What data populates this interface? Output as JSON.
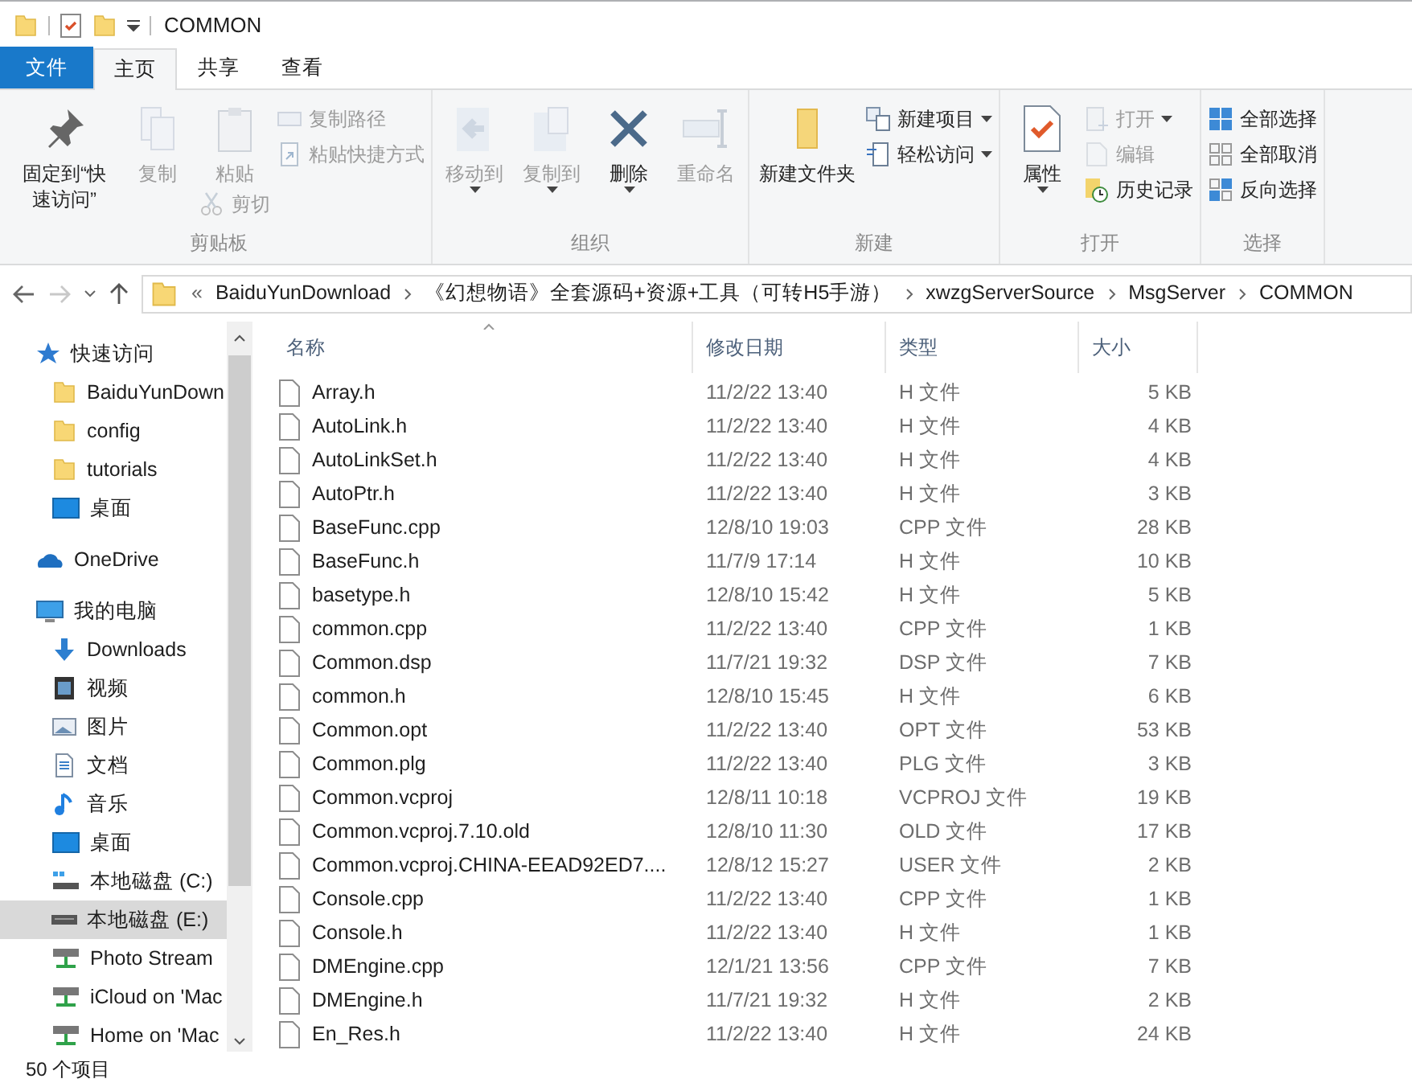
{
  "window": {
    "title": "COMMON"
  },
  "tabs": [
    {
      "label": "文件",
      "kind": "file",
      "selected": false
    },
    {
      "label": "主页",
      "kind": "tab",
      "selected": true
    },
    {
      "label": "共享",
      "kind": "tab",
      "selected": false
    },
    {
      "label": "查看",
      "kind": "tab",
      "selected": false
    }
  ],
  "ribbon": {
    "groups": [
      {
        "label": "剪贴板",
        "items": [
          {
            "kind": "large",
            "label": "固定到“快速访问”",
            "disabled": false,
            "dropdown": false
          },
          {
            "kind": "large",
            "label": "复制",
            "disabled": true,
            "dropdown": false
          },
          {
            "kind": "large",
            "label": "粘贴",
            "disabled": true,
            "dropdown": false,
            "below": {
              "label": "剪切",
              "disabled": true
            }
          },
          {
            "kind": "stack",
            "items": [
              {
                "label": "复制路径",
                "disabled": true,
                "dropdown": false
              },
              {
                "label": "粘贴快捷方式",
                "disabled": true,
                "dropdown": false
              }
            ]
          }
        ]
      },
      {
        "label": "组织",
        "items": [
          {
            "kind": "large",
            "label": "移动到",
            "disabled": true,
            "dropdown": true
          },
          {
            "kind": "large",
            "label": "复制到",
            "disabled": true,
            "dropdown": true
          },
          {
            "kind": "large",
            "label": "删除",
            "disabled": false,
            "dropdown": true
          },
          {
            "kind": "large",
            "label": "重命名",
            "disabled": true,
            "dropdown": false
          }
        ]
      },
      {
        "label": "新建",
        "items": [
          {
            "kind": "large",
            "label": "新建文件夹",
            "disabled": false,
            "dropdown": false
          },
          {
            "kind": "stack",
            "items": [
              {
                "label": "新建项目",
                "disabled": false,
                "dropdown": true
              },
              {
                "label": "轻松访问",
                "disabled": false,
                "dropdown": true
              }
            ]
          }
        ]
      },
      {
        "label": "打开",
        "items": [
          {
            "kind": "large",
            "label": "属性",
            "disabled": false,
            "dropdown": true
          },
          {
            "kind": "stack",
            "items": [
              {
                "label": "打开",
                "disabled": true,
                "dropdown": true
              },
              {
                "label": "编辑",
                "disabled": true,
                "dropdown": false
              },
              {
                "label": "历史记录",
                "disabled": false,
                "dropdown": false
              }
            ]
          }
        ]
      },
      {
        "label": "选择",
        "items": [
          {
            "kind": "stack",
            "items": [
              {
                "label": "全部选择",
                "disabled": false,
                "dropdown": false
              },
              {
                "label": "全部取消",
                "disabled": false,
                "dropdown": false
              },
              {
                "label": "反向选择",
                "disabled": false,
                "dropdown": false
              }
            ]
          }
        ]
      }
    ]
  },
  "address_bar": {
    "back_disabled": false,
    "forward_disabled": true,
    "overflow": "«",
    "segments": [
      "BaiduYunDownload",
      "《幻想物语》全套源码+资源+工具（可转H5手游）",
      "xwzgServerSource",
      "MsgServer",
      "COMMON"
    ]
  },
  "sidebar": {
    "items": [
      {
        "label": "快速访问",
        "selected": false,
        "children": [
          {
            "label": "BaiduYunDown",
            "selected": false
          },
          {
            "label": "config",
            "selected": false
          },
          {
            "label": "tutorials",
            "selected": false
          },
          {
            "label": "桌面",
            "selected": false
          }
        ]
      },
      {
        "label": "OneDrive",
        "selected": false
      },
      {
        "label": "我的电脑",
        "selected": false,
        "children": [
          {
            "label": "Downloads",
            "selected": false
          },
          {
            "label": "视频",
            "selected": false
          },
          {
            "label": "图片",
            "selected": false
          },
          {
            "label": "文档",
            "selected": false
          },
          {
            "label": "音乐",
            "selected": false
          },
          {
            "label": "桌面",
            "selected": false
          },
          {
            "label": "本地磁盘 (C:)",
            "selected": false
          },
          {
            "label": "本地磁盘 (E:)",
            "selected": true
          },
          {
            "label": "Photo Stream",
            "selected": false
          },
          {
            "label": "iCloud on 'Mac",
            "selected": false
          },
          {
            "label": "Home on 'Mac",
            "selected": false
          }
        ]
      }
    ]
  },
  "table": {
    "columns": [
      {
        "label": "名称",
        "sorted": true
      },
      {
        "label": "修改日期",
        "sorted": false
      },
      {
        "label": "类型",
        "sorted": false
      },
      {
        "label": "大小",
        "sorted": false
      }
    ],
    "rows": [
      {
        "name": "Array.h",
        "date": "11/2/22 13:40",
        "type": "H 文件",
        "size": "5 KB"
      },
      {
        "name": "AutoLink.h",
        "date": "11/2/22 13:40",
        "type": "H 文件",
        "size": "4 KB"
      },
      {
        "name": "AutoLinkSet.h",
        "date": "11/2/22 13:40",
        "type": "H 文件",
        "size": "4 KB"
      },
      {
        "name": "AutoPtr.h",
        "date": "11/2/22 13:40",
        "type": "H 文件",
        "size": "3 KB"
      },
      {
        "name": "BaseFunc.cpp",
        "date": "12/8/10 19:03",
        "type": "CPP 文件",
        "size": "28 KB"
      },
      {
        "name": "BaseFunc.h",
        "date": "11/7/9 17:14",
        "type": "H 文件",
        "size": "10 KB"
      },
      {
        "name": "basetype.h",
        "date": "12/8/10 15:42",
        "type": "H 文件",
        "size": "5 KB"
      },
      {
        "name": "common.cpp",
        "date": "11/2/22 13:40",
        "type": "CPP 文件",
        "size": "1 KB"
      },
      {
        "name": "Common.dsp",
        "date": "11/7/21 19:32",
        "type": "DSP 文件",
        "size": "7 KB"
      },
      {
        "name": "common.h",
        "date": "12/8/10 15:45",
        "type": "H 文件",
        "size": "6 KB"
      },
      {
        "name": "Common.opt",
        "date": "11/2/22 13:40",
        "type": "OPT 文件",
        "size": "53 KB"
      },
      {
        "name": "Common.plg",
        "date": "11/2/22 13:40",
        "type": "PLG 文件",
        "size": "3 KB"
      },
      {
        "name": "Common.vcproj",
        "date": "12/8/11 10:18",
        "type": "VCPROJ 文件",
        "size": "19 KB"
      },
      {
        "name": "Common.vcproj.7.10.old",
        "date": "12/8/10 11:30",
        "type": "OLD 文件",
        "size": "17 KB"
      },
      {
        "name": "Common.vcproj.CHINA-EEAD92ED7....",
        "date": "12/8/12 15:27",
        "type": "USER 文件",
        "size": "2 KB"
      },
      {
        "name": "Console.cpp",
        "date": "11/2/22 13:40",
        "type": "CPP 文件",
        "size": "1 KB"
      },
      {
        "name": "Console.h",
        "date": "11/2/22 13:40",
        "type": "H 文件",
        "size": "1 KB"
      },
      {
        "name": "DMEngine.cpp",
        "date": "12/1/21 13:56",
        "type": "CPP 文件",
        "size": "7 KB"
      },
      {
        "name": "DMEngine.h",
        "date": "11/7/21 19:32",
        "type": "H 文件",
        "size": "2 KB"
      },
      {
        "name": "En_Res.h",
        "date": "11/2/22 13:40",
        "type": "H 文件",
        "size": "24 KB"
      }
    ]
  },
  "status_bar": {
    "item_count": "50 个项目"
  }
}
